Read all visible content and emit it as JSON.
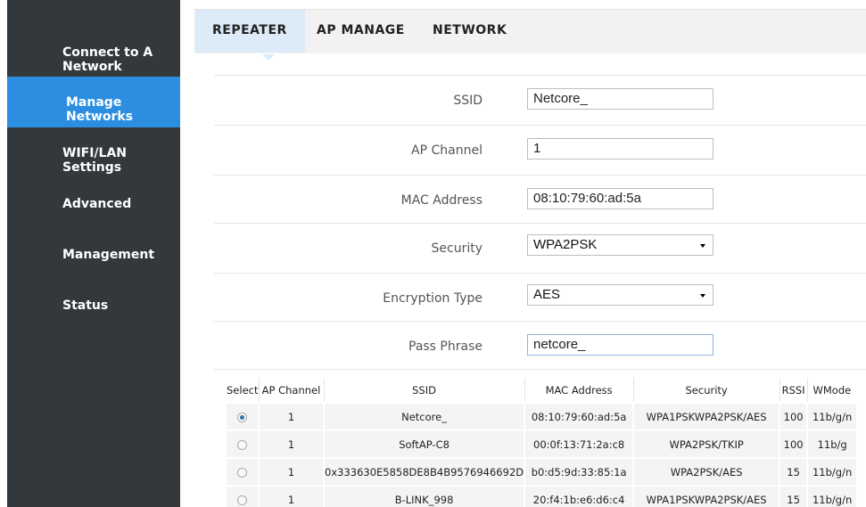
{
  "sidebar": {
    "items": [
      {
        "label": "Connect to A Network",
        "active": false
      },
      {
        "label": "Manage Networks",
        "active": true
      },
      {
        "label": "WIFI/LAN Settings",
        "active": false
      },
      {
        "label": "Advanced",
        "active": false
      },
      {
        "label": "Management",
        "active": false
      },
      {
        "label": "Status",
        "active": false
      }
    ]
  },
  "tabs": [
    {
      "label": "REPEATER",
      "active": true
    },
    {
      "label": "AP MANAGE",
      "active": false
    },
    {
      "label": "NETWORK",
      "active": false
    }
  ],
  "form": {
    "ssid": {
      "label": "SSID",
      "value": "Netcore_"
    },
    "ap_channel": {
      "label": "AP Channel",
      "value": "1"
    },
    "mac_address": {
      "label": "MAC Address",
      "value": "08:10:79:60:ad:5a"
    },
    "security": {
      "label": "Security",
      "value": "WPA2PSK"
    },
    "encryption_type": {
      "label": "Encryption Type",
      "value": "AES"
    },
    "pass_phrase": {
      "label": "Pass Phrase",
      "value": "netcore_"
    }
  },
  "scan_table": {
    "columns": [
      "Select",
      "AP Channel",
      "SSID",
      "MAC Address",
      "Security",
      "RSSI",
      "WMode"
    ],
    "rows": [
      {
        "selected": true,
        "channel": "1",
        "ssid": "Netcore_",
        "mac": "08:10:79:60:ad:5a",
        "security": "WPA1PSKWPA2PSK/AES",
        "rssi": "100",
        "wmode": "11b/g/n"
      },
      {
        "selected": false,
        "channel": "1",
        "ssid": "SoftAP-C8",
        "mac": "00:0f:13:71:2a:c8",
        "security": "WPA2PSK/TKIP",
        "rssi": "100",
        "wmode": "11b/g"
      },
      {
        "selected": false,
        "channel": "1",
        "ssid": "0x333630E5858DE8B4B9576946692D",
        "mac": "b0:d5:9d:33:85:1a",
        "security": "WPA2PSK/AES",
        "rssi": "15",
        "wmode": "11b/g/n"
      },
      {
        "selected": false,
        "channel": "1",
        "ssid": "B-LINK_998",
        "mac": "20:f4:1b:e6:d6:c4",
        "security": "WPA1PSKWPA2PSK/AES",
        "rssi": "15",
        "wmode": "11b/g/n"
      }
    ]
  },
  "colors": {
    "sidebar_bg": "#33383c",
    "active_item": "#2b8ee0",
    "tab_active": "#ddeaf8"
  }
}
